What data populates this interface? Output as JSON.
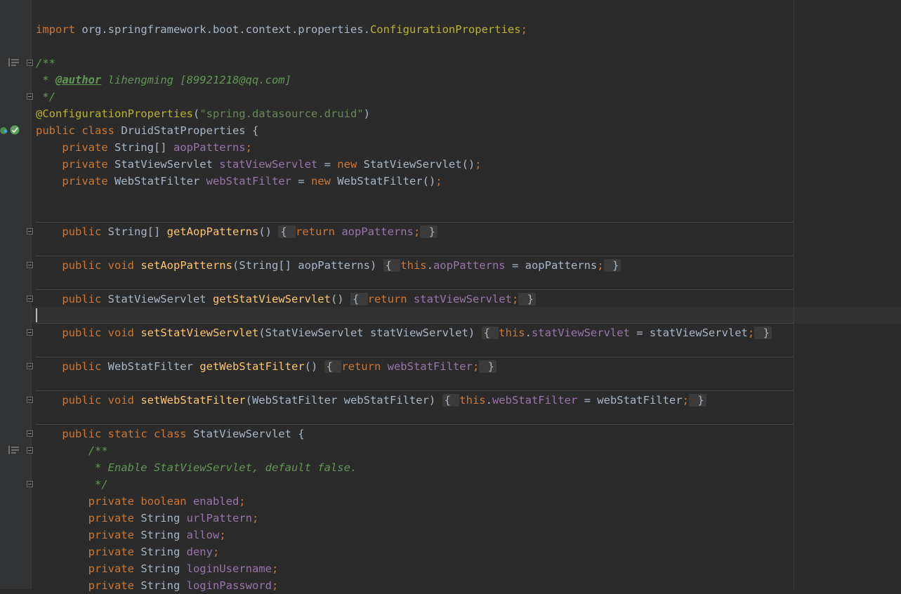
{
  "editor": {
    "lines": [
      {
        "segments": [
          {
            "t": "import ",
            "c": "kw"
          },
          {
            "t": "org.springframework.boot.context.properties.",
            "c": "ty"
          },
          {
            "t": "ConfigurationProperties",
            "c": "ann"
          },
          {
            "t": ";",
            "c": "kw"
          }
        ]
      },
      {
        "segments": [
          {
            "t": "/**",
            "c": "cmt"
          }
        ]
      },
      {
        "segments": [
          {
            "t": " * ",
            "c": "cmt"
          },
          {
            "t": "@author",
            "c": "tag"
          },
          {
            "t": " lihengming [89921218@qq.com]",
            "c": "cmt"
          }
        ]
      },
      {
        "segments": [
          {
            "t": " */",
            "c": "cmt"
          }
        ]
      },
      {
        "segments": [
          {
            "t": "@ConfigurationProperties",
            "c": "ann"
          },
          {
            "t": "(",
            "c": "ty"
          },
          {
            "t": "\"spring.datasource.druid\"",
            "c": "str"
          },
          {
            "t": ")",
            "c": "ty"
          }
        ]
      },
      {
        "segments": [
          {
            "t": "public ",
            "c": "kw"
          },
          {
            "t": "class ",
            "c": "kw"
          },
          {
            "t": "DruidStatProperties {",
            "c": "ty"
          }
        ]
      },
      {
        "segments": [
          {
            "t": "    private ",
            "c": "kw"
          },
          {
            "t": "String[] ",
            "c": "ty"
          },
          {
            "t": "aopPatterns",
            "c": "fld"
          },
          {
            "t": ";",
            "c": "kw"
          }
        ]
      },
      {
        "segments": [
          {
            "t": "    private ",
            "c": "kw"
          },
          {
            "t": "StatViewServlet ",
            "c": "ty"
          },
          {
            "t": "statViewServlet",
            "c": "fld"
          },
          {
            "t": " = ",
            "c": "ty"
          },
          {
            "t": "new ",
            "c": "kw"
          },
          {
            "t": "StatViewServlet()",
            "c": "ty"
          },
          {
            "t": ";",
            "c": "kw"
          }
        ]
      },
      {
        "segments": [
          {
            "t": "    private ",
            "c": "kw"
          },
          {
            "t": "WebStatFilter ",
            "c": "ty"
          },
          {
            "t": "webStatFilter",
            "c": "fld"
          },
          {
            "t": " = ",
            "c": "ty"
          },
          {
            "t": "new ",
            "c": "kw"
          },
          {
            "t": "WebStatFilter()",
            "c": "ty"
          },
          {
            "t": ";",
            "c": "kw"
          }
        ]
      },
      {
        "segments": [
          {
            "t": "    public ",
            "c": "kw"
          },
          {
            "t": "String[] ",
            "c": "ty"
          },
          {
            "t": "getAopPatterns",
            "c": "mth"
          },
          {
            "t": "() ",
            "c": "ty"
          },
          {
            "t": "{ ",
            "c": "fb"
          },
          {
            "t": "return ",
            "c": "kw"
          },
          {
            "t": "aopPatterns",
            "c": "fld"
          },
          {
            "t": ";",
            "c": "kw"
          },
          {
            "t": " }",
            "c": "fb"
          }
        ]
      },
      {
        "segments": [
          {
            "t": "    public ",
            "c": "kw"
          },
          {
            "t": "void ",
            "c": "kw"
          },
          {
            "t": "setAopPatterns",
            "c": "mth"
          },
          {
            "t": "(String[] aopPatterns) ",
            "c": "ty"
          },
          {
            "t": "{ ",
            "c": "fb"
          },
          {
            "t": "this",
            "c": "kw"
          },
          {
            "t": ".",
            "c": "ty"
          },
          {
            "t": "aopPatterns",
            "c": "fld"
          },
          {
            "t": " = aopPatterns",
            "c": "ty"
          },
          {
            "t": ";",
            "c": "kw"
          },
          {
            "t": " }",
            "c": "fb"
          }
        ]
      },
      {
        "segments": [
          {
            "t": "    public ",
            "c": "kw"
          },
          {
            "t": "StatViewServlet ",
            "c": "ty"
          },
          {
            "t": "getStatViewServlet",
            "c": "mth"
          },
          {
            "t": "() ",
            "c": "ty"
          },
          {
            "t": "{ ",
            "c": "fb"
          },
          {
            "t": "return ",
            "c": "kw"
          },
          {
            "t": "statViewServlet",
            "c": "fld"
          },
          {
            "t": ";",
            "c": "kw"
          },
          {
            "t": " }",
            "c": "fb"
          }
        ]
      },
      {
        "segments": [
          {
            "t": "    public ",
            "c": "kw"
          },
          {
            "t": "void ",
            "c": "kw"
          },
          {
            "t": "setStatViewServlet",
            "c": "mth"
          },
          {
            "t": "(StatViewServlet statViewServlet) ",
            "c": "ty"
          },
          {
            "t": "{ ",
            "c": "fb"
          },
          {
            "t": "this",
            "c": "kw"
          },
          {
            "t": ".",
            "c": "ty"
          },
          {
            "t": "statViewServlet",
            "c": "fld"
          },
          {
            "t": " = statViewServlet",
            "c": "ty"
          },
          {
            "t": ";",
            "c": "kw"
          },
          {
            "t": " }",
            "c": "fb"
          }
        ]
      },
      {
        "segments": [
          {
            "t": "    public ",
            "c": "kw"
          },
          {
            "t": "WebStatFilter ",
            "c": "ty"
          },
          {
            "t": "getWebStatFilter",
            "c": "mth"
          },
          {
            "t": "() ",
            "c": "ty"
          },
          {
            "t": "{ ",
            "c": "fb"
          },
          {
            "t": "return ",
            "c": "kw"
          },
          {
            "t": "webStatFilter",
            "c": "fld"
          },
          {
            "t": ";",
            "c": "kw"
          },
          {
            "t": " }",
            "c": "fb"
          }
        ]
      },
      {
        "segments": [
          {
            "t": "    public ",
            "c": "kw"
          },
          {
            "t": "void ",
            "c": "kw"
          },
          {
            "t": "setWebStatFilter",
            "c": "mth"
          },
          {
            "t": "(WebStatFilter webStatFilter) ",
            "c": "ty"
          },
          {
            "t": "{ ",
            "c": "fb"
          },
          {
            "t": "this",
            "c": "kw"
          },
          {
            "t": ".",
            "c": "ty"
          },
          {
            "t": "webStatFilter",
            "c": "fld"
          },
          {
            "t": " = webStatFilter",
            "c": "ty"
          },
          {
            "t": ";",
            "c": "kw"
          },
          {
            "t": " }",
            "c": "fb"
          }
        ]
      },
      {
        "segments": [
          {
            "t": "    public ",
            "c": "kw"
          },
          {
            "t": "static ",
            "c": "kw"
          },
          {
            "t": "class ",
            "c": "kw"
          },
          {
            "t": "StatViewServlet {",
            "c": "ty"
          }
        ]
      },
      {
        "segments": [
          {
            "t": "        /**",
            "c": "cmt"
          }
        ]
      },
      {
        "segments": [
          {
            "t": "         * Enable StatViewServlet, default false.",
            "c": "cmt"
          }
        ]
      },
      {
        "segments": [
          {
            "t": "         */",
            "c": "cmt"
          }
        ]
      },
      {
        "segments": [
          {
            "t": "        private ",
            "c": "kw"
          },
          {
            "t": "boolean ",
            "c": "kw"
          },
          {
            "t": "enabled",
            "c": "fld"
          },
          {
            "t": ";",
            "c": "kw"
          }
        ]
      },
      {
        "segments": [
          {
            "t": "        private ",
            "c": "kw"
          },
          {
            "t": "String ",
            "c": "ty"
          },
          {
            "t": "urlPattern",
            "c": "fld"
          },
          {
            "t": ";",
            "c": "kw"
          }
        ]
      },
      {
        "segments": [
          {
            "t": "        private ",
            "c": "kw"
          },
          {
            "t": "String ",
            "c": "ty"
          },
          {
            "t": "allow",
            "c": "fld"
          },
          {
            "t": ";",
            "c": "kw"
          }
        ]
      },
      {
        "segments": [
          {
            "t": "        private ",
            "c": "kw"
          },
          {
            "t": "String ",
            "c": "ty"
          },
          {
            "t": "deny",
            "c": "fld"
          },
          {
            "t": ";",
            "c": "kw"
          }
        ]
      },
      {
        "segments": [
          {
            "t": "        private ",
            "c": "kw"
          },
          {
            "t": "String ",
            "c": "ty"
          },
          {
            "t": "loginUsername",
            "c": "fld"
          },
          {
            "t": ";",
            "c": "kw"
          }
        ]
      },
      {
        "segments": [
          {
            "t": "        private ",
            "c": "kw"
          },
          {
            "t": "String ",
            "c": "ty"
          },
          {
            "t": "loginPassword",
            "c": "fld"
          },
          {
            "t": ";",
            "c": "kw"
          }
        ]
      }
    ]
  }
}
